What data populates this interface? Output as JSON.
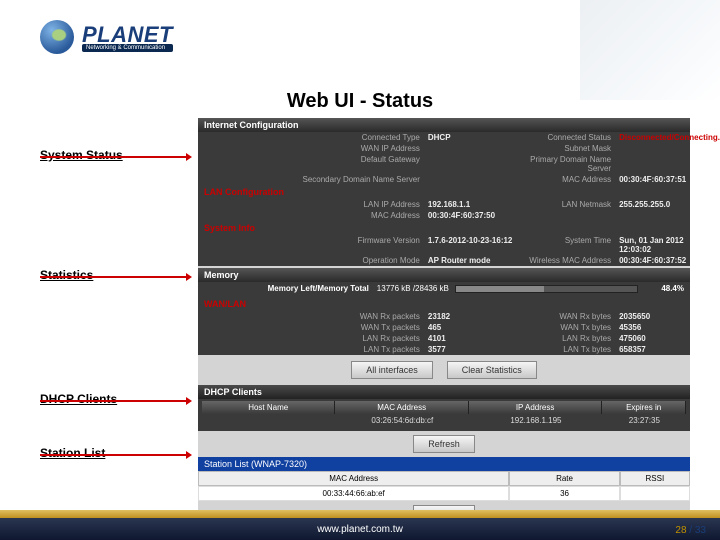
{
  "logo": {
    "brand": "PLANET",
    "tagline": "Networking & Communication"
  },
  "title": "Web UI - Status",
  "labels": {
    "system_status": "System Status",
    "statistics": "Statistics",
    "dhcp_clients": "DHCP Clients",
    "station_list": "Station List"
  },
  "internet": {
    "header": "Internet Configuration",
    "rows": [
      {
        "lk": "Connected Type",
        "lv": "DHCP",
        "rk": "Connected Status",
        "rv": "Disconnected/Connecting..."
      },
      {
        "lk": "WAN IP Address",
        "lv": "",
        "rk": "Subnet Mask",
        "rv": ""
      },
      {
        "lk": "Default Gateway",
        "lv": "",
        "rk": "Primary Domain Name Server",
        "rv": ""
      },
      {
        "lk": "Secondary Domain Name Server",
        "lv": "",
        "rk": "MAC Address",
        "rv": "00:30:4F:60:37:51"
      }
    ]
  },
  "lan": {
    "header": "LAN Configuration",
    "rows": [
      {
        "lk": "LAN IP Address",
        "lv": "192.168.1.1",
        "rk": "LAN Netmask",
        "rv": "255.255.255.0"
      },
      {
        "lk": "MAC Address",
        "lv": "00:30:4F:60:37:50",
        "rk": "",
        "rv": ""
      }
    ]
  },
  "sys": {
    "header": "System Info",
    "rows": [
      {
        "lk": "Firmware Version",
        "lv": "1.7.6-2012-10-23-16:12",
        "rk": "System Time",
        "rv": "Sun, 01 Jan 2012 12:03:02"
      },
      {
        "lk": "Operation Mode",
        "lv": "AP Router mode",
        "rk": "Wireless MAC Address",
        "rv": "00:30:4F:60:37:52"
      }
    ]
  },
  "memory": {
    "header": "Memory",
    "label": "Memory Left/Memory Total",
    "value": "13776 kB /28436 kB",
    "percent": "48.4%",
    "percentNum": 48.4
  },
  "wanlan": {
    "header": "WAN/LAN",
    "rows": [
      {
        "lk": "WAN Rx packets",
        "lv": "23182",
        "rk": "WAN Rx bytes",
        "rv": "2035650"
      },
      {
        "lk": "WAN Tx packets",
        "lv": "465",
        "rk": "WAN Tx bytes",
        "rv": "45356"
      },
      {
        "lk": "LAN Rx packets",
        "lv": "4101",
        "rk": "LAN Rx bytes",
        "rv": "475060"
      },
      {
        "lk": "LAN Tx packets",
        "lv": "3577",
        "rk": "LAN Tx bytes",
        "rv": "658357"
      }
    ]
  },
  "buttons": {
    "all": "All interfaces",
    "clear": "Clear Statistics",
    "refresh": "Refresh"
  },
  "dhcp": {
    "header": "DHCP Clients",
    "columns": [
      "Host Name",
      "MAC Address",
      "IP Address",
      "Expires in"
    ],
    "row": [
      "",
      "03:26:54:6d:db:cf",
      "192.168.1.195",
      "23:27:35"
    ]
  },
  "station": {
    "header": "Station List (WNAP-7320)",
    "columns": [
      "MAC Address",
      "Rate",
      "RSSI"
    ],
    "row": [
      "00:33:44:66:ab:ef",
      "36",
      ""
    ]
  },
  "footer": {
    "url": "www.planet.com.tw",
    "page_cur": "28",
    "page_sep": " / ",
    "page_total": "33"
  }
}
